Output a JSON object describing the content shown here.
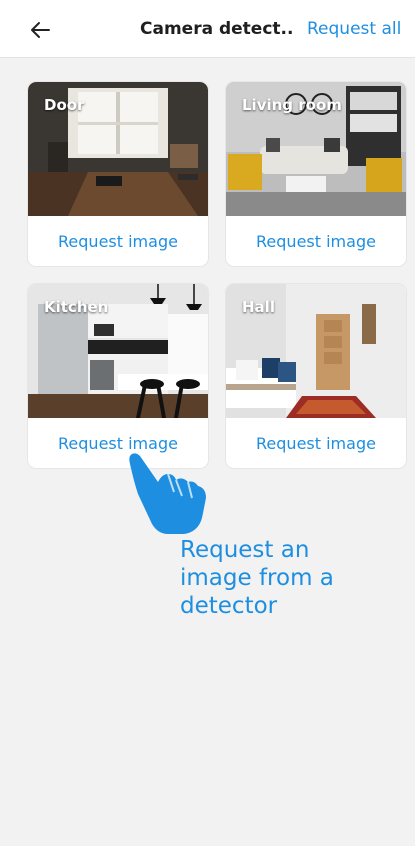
{
  "header": {
    "title": "Camera detect...",
    "request_all_label": "Request all"
  },
  "cards": [
    {
      "label": "Door",
      "button": "Request image"
    },
    {
      "label": "Living room",
      "button": "Request image"
    },
    {
      "label": "Kitchen",
      "button": "Request image"
    },
    {
      "label": "Hall",
      "button": "Request image"
    }
  ],
  "hint": {
    "text": "Request an image from a detector"
  },
  "colors": {
    "accent": "#1e8fe0",
    "background": "#f2f2f2",
    "card": "#ffffff"
  },
  "icons": {
    "back": "arrow-left-icon",
    "hand": "pointing-hand-icon"
  }
}
